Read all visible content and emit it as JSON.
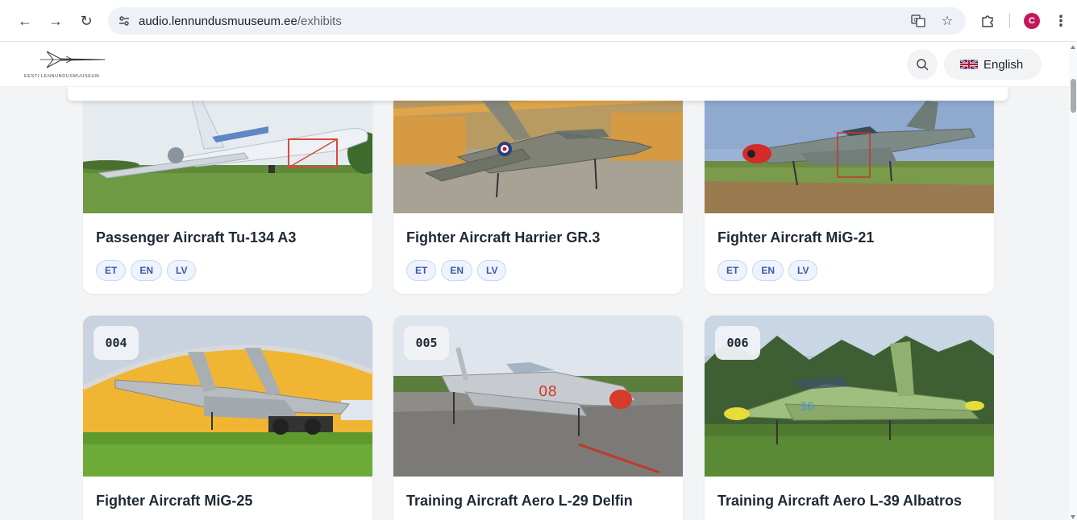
{
  "browser": {
    "url_host": "audio.lennundusmuuseum.ee",
    "url_path": "/exhibits",
    "profile_initial": "C"
  },
  "site": {
    "logo_text": "EESTI LENNUNDUSMUUSEUM",
    "language_label": "English"
  },
  "exhibits": [
    {
      "number": "",
      "title": "Passenger Aircraft Tu-134 A3",
      "languages": [
        "ET",
        "EN",
        "LV"
      ]
    },
    {
      "number": "",
      "title": "Fighter Aircraft Harrier GR.3",
      "languages": [
        "ET",
        "EN",
        "LV"
      ]
    },
    {
      "number": "",
      "title": "Fighter Aircraft MiG-21",
      "languages": [
        "ET",
        "EN",
        "LV"
      ]
    },
    {
      "number": "004",
      "title": "Fighter Aircraft MiG-25",
      "languages": []
    },
    {
      "number": "005",
      "title": "Training Aircraft Aero L-29 Delfin",
      "languages": []
    },
    {
      "number": "006",
      "title": "Training Aircraft Aero L-39 Albatros",
      "languages": []
    }
  ],
  "colors": {
    "chip_bg": "#eef3fd",
    "chip_text": "#3b5aa8",
    "avatar": "#c2185b"
  }
}
